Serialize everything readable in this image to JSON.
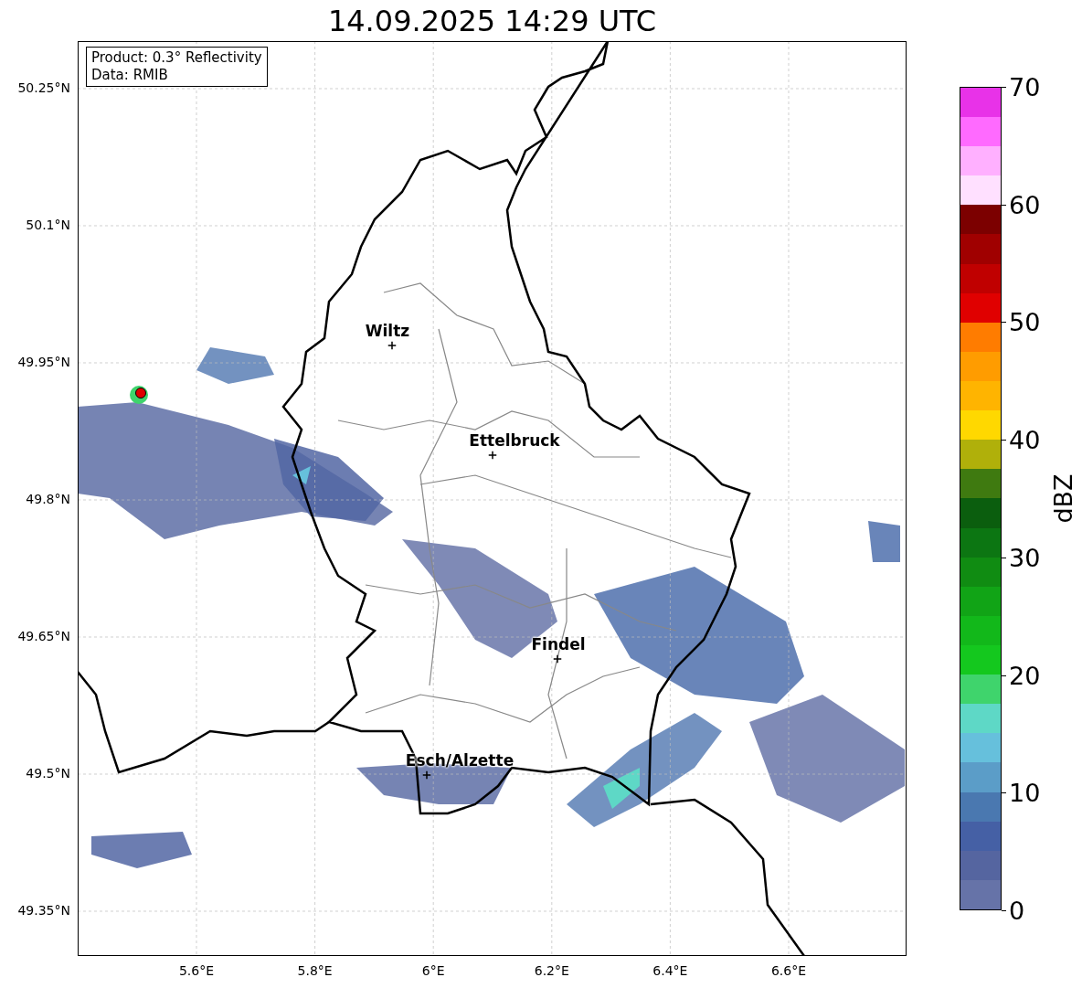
{
  "title": "14.09.2025 14:29 UTC",
  "info_box": [
    "Product: 0.3° Reflectivity",
    "Data: RMIB"
  ],
  "map": {
    "lat_ticks": [
      "50.25°N",
      "50.1°N",
      "49.95°N",
      "49.8°N",
      "49.65°N",
      "49.5°N",
      "49.35°N"
    ],
    "lon_ticks": [
      "5.6°E",
      "5.8°E",
      "6°E",
      "6.2°E",
      "6.4°E",
      "6.6°E"
    ],
    "cities": [
      {
        "name": "Wiltz"
      },
      {
        "name": "Ettelbruck"
      },
      {
        "name": "Findel"
      },
      {
        "name": "Esch/Alzette"
      }
    ]
  },
  "colorbar": {
    "label": "dBZ",
    "ticks": [
      "70",
      "60",
      "50",
      "40",
      "30",
      "20",
      "10",
      "0"
    ],
    "segments": [
      {
        "color": "#6673a8"
      },
      {
        "color": "#5565a0"
      },
      {
        "color": "#4560a5"
      },
      {
        "color": "#4a78b0"
      },
      {
        "color": "#5b9dc8"
      },
      {
        "color": "#66c0dc"
      },
      {
        "color": "#5ed8c6"
      },
      {
        "color": "#3fd46c"
      },
      {
        "color": "#14c81e"
      },
      {
        "color": "#12b81a"
      },
      {
        "color": "#11a416"
      },
      {
        "color": "#108c12"
      },
      {
        "color": "#0c7612"
      },
      {
        "color": "#0b5e0e"
      },
      {
        "color": "#3f7a10"
      },
      {
        "color": "#b0b00a"
      },
      {
        "color": "#ffd800"
      },
      {
        "color": "#ffb400"
      },
      {
        "color": "#ff9c00"
      },
      {
        "color": "#ff7c00"
      },
      {
        "color": "#e00000"
      },
      {
        "color": "#c00000"
      },
      {
        "color": "#a00000"
      },
      {
        "color": "#7c0000"
      },
      {
        "color": "#ffe0ff"
      },
      {
        "color": "#ffb0ff"
      },
      {
        "color": "#ff6aff"
      },
      {
        "color": "#e832e8"
      }
    ]
  }
}
